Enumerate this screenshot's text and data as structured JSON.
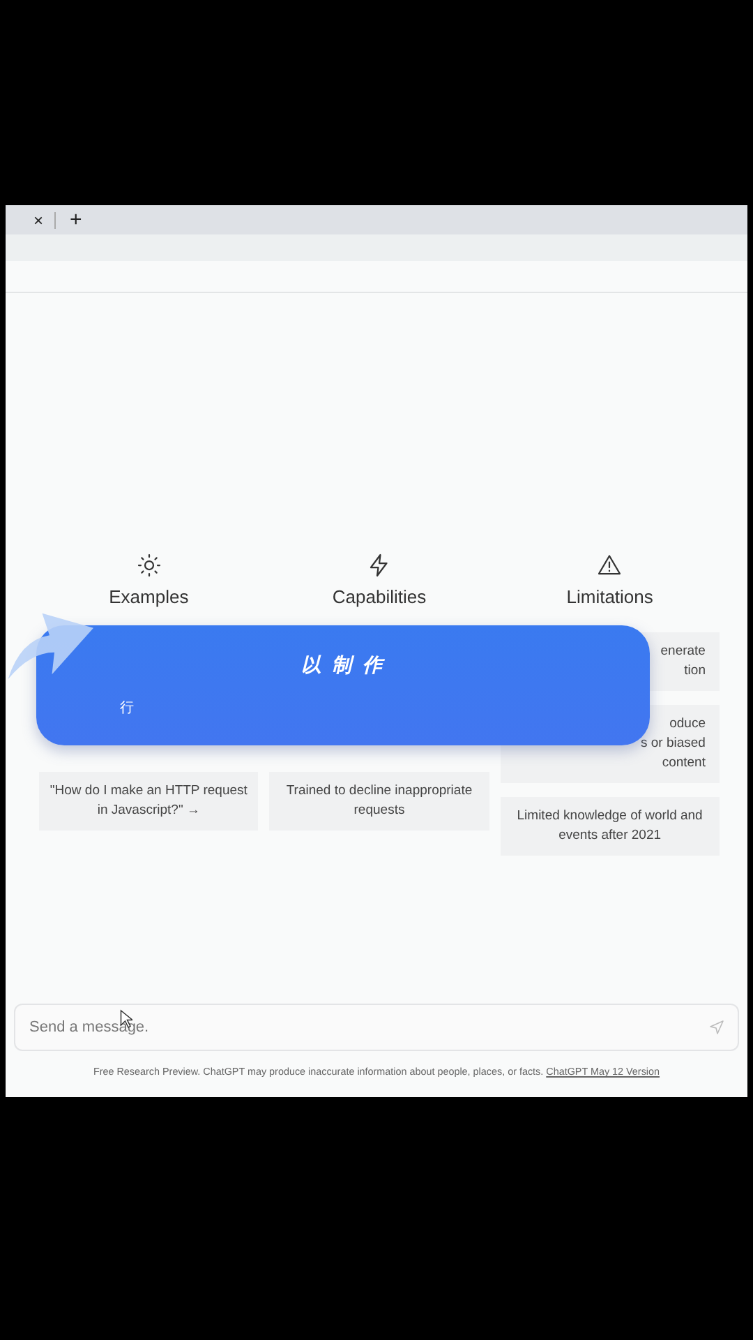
{
  "tab_bar": {
    "close": "×",
    "new_tab": "+"
  },
  "columns": [
    {
      "title": "Examples",
      "cards": [
        {
          "lines": [
            "\"How do I make an HTTP request",
            "in Javascript?\" →"
          ],
          "kind": "full"
        }
      ]
    },
    {
      "title": "Capabilities",
      "cards": [
        {
          "lines": [
            "Trained to decline inappropriate",
            "requests"
          ],
          "kind": "full"
        }
      ]
    },
    {
      "title": "Limitations",
      "cards": [
        {
          "lines": [
            "enerate",
            "tion"
          ],
          "kind": "partial"
        },
        {
          "lines": [
            "oduce",
            "s or biased",
            "content"
          ],
          "kind": "partial"
        },
        {
          "lines": [
            "Limited knowledge of world and",
            "events after 2021"
          ],
          "kind": "full"
        }
      ]
    }
  ],
  "banner": {
    "title": "以 制 作",
    "subtitle": "行"
  },
  "message_field": {
    "placeholder": "Send a message."
  },
  "footer": {
    "text": "Free Research Preview. ChatGPT may produce inaccurate information about people, places, or facts.",
    "link": "ChatGPT May 12 Version"
  }
}
